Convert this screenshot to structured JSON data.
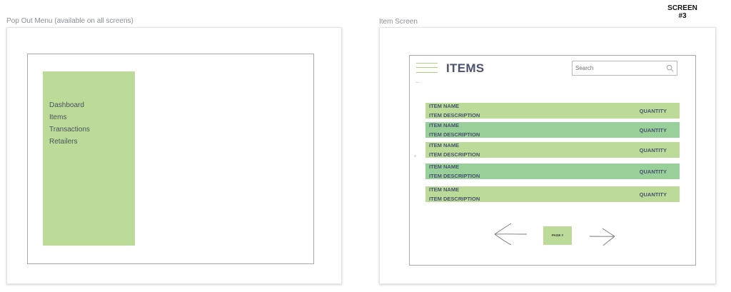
{
  "captions": {
    "popout": "Pop Out Menu (available on all screens)",
    "item_screen": "Item Screen"
  },
  "screen_tag": {
    "line1": "SCREEN",
    "line2": "#3"
  },
  "menu": {
    "items": [
      "Dashboard",
      "Items",
      "Transactions",
      "Retailers"
    ],
    "panel_color": "#bddb98"
  },
  "item_screen": {
    "title": "ITEMS",
    "search_placeholder": "Search",
    "rows": [
      {
        "name": "ITEM NAME",
        "description": "ITEM DESCRIPTION",
        "quantity": "QUANTITY"
      },
      {
        "name": "ITEM NAME",
        "description": "ITEM DESCRIPTION",
        "quantity": "QUANTITY"
      },
      {
        "name": "ITEM NAME",
        "description": "ITEM DESCRIPTION",
        "quantity": "QUANTITY"
      },
      {
        "name": "ITEM NAME",
        "description": "ITEM DESCRIPTION",
        "quantity": "QUANTITY"
      },
      {
        "name": "ITEM NAME",
        "description": "ITEM DESCRIPTION",
        "quantity": "QUANTITY"
      }
    ],
    "page_label": "PAGE #",
    "row_colors": {
      "light": "#bddb98",
      "dark": "#99cf98"
    }
  },
  "icons": {
    "menu": "hamburger-icon",
    "search": "search-icon",
    "prev": "arrow-left-icon",
    "next": "arrow-right-icon"
  }
}
